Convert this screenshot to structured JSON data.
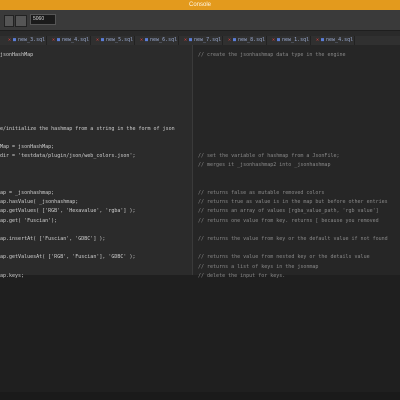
{
  "window": {
    "title": "Console"
  },
  "toolbar": {
    "field_value": "5060"
  },
  "tabs": [
    {
      "label": "new_3.sql"
    },
    {
      "label": "new_4.sql"
    },
    {
      "label": "new_5.sql"
    },
    {
      "label": "new_6.sql"
    },
    {
      "label": "new_7.sql"
    },
    {
      "label": "new_8.sql"
    },
    {
      "label": "new_1.sql"
    },
    {
      "label": "new_4.sql"
    }
  ],
  "code_lines": [
    {
      "code": "jsonHashMap",
      "comment": "// create the jsonhashmap data type in the engine"
    },
    {
      "code": "",
      "comment": ""
    },
    {
      "code": "",
      "comment": ""
    },
    {
      "code": "",
      "comment": ""
    },
    {
      "code": "",
      "comment": ""
    },
    {
      "code": "",
      "comment": ""
    },
    {
      "code": "",
      "comment": ""
    },
    {
      "code": "",
      "comment": ""
    },
    {
      "code": "e/initialize the hashmap from a string in the form of json",
      "comment": ""
    },
    {
      "code": "",
      "comment": ""
    },
    {
      "code": "Map = jsonHashMap;",
      "comment": ""
    },
    {
      "code": "dir = 'testdata/plugin/json/web_colors.json';",
      "comment": "// set the variable of hashmap from a JsonFile;"
    },
    {
      "code": "",
      "comment": "// merges it _jsonhashmap2 into _jsonhashmap"
    },
    {
      "code": "",
      "comment": ""
    },
    {
      "code": "",
      "comment": ""
    },
    {
      "code": "ap = _jsonhashmap;",
      "comment": "// returns false as mutable removed colors"
    },
    {
      "code": "ap.hasValue( _jsonhashmap;",
      "comment": "// returns true as value is in the map but before other entries"
    },
    {
      "code": "ap.getValues( ['RGB', 'Hexavalue', 'rgba'] );",
      "comment": "// returns an array of values [rgba_value_path, 'rgb value']"
    },
    {
      "code": "ap.get( 'Fuscian');",
      "comment": "// returns one value from key. returns [ because you removed"
    },
    {
      "code": "",
      "comment": ""
    },
    {
      "code": "ap.insertAt( ['Fuscian', 'GDBC'] );",
      "comment": "// returns the value from key or the default value if not found"
    },
    {
      "code": "",
      "comment": ""
    },
    {
      "code": "ap.getValuesAt( ['RGB', 'Fuscian'], 'GDBC' );",
      "comment": "// returns the value from nested key or the details value"
    },
    {
      "code": "",
      "comment": "// returns a list of keys in the jsonmap"
    },
    {
      "code": "ap.keys;",
      "comment": "// delete the input for keys."
    }
  ]
}
